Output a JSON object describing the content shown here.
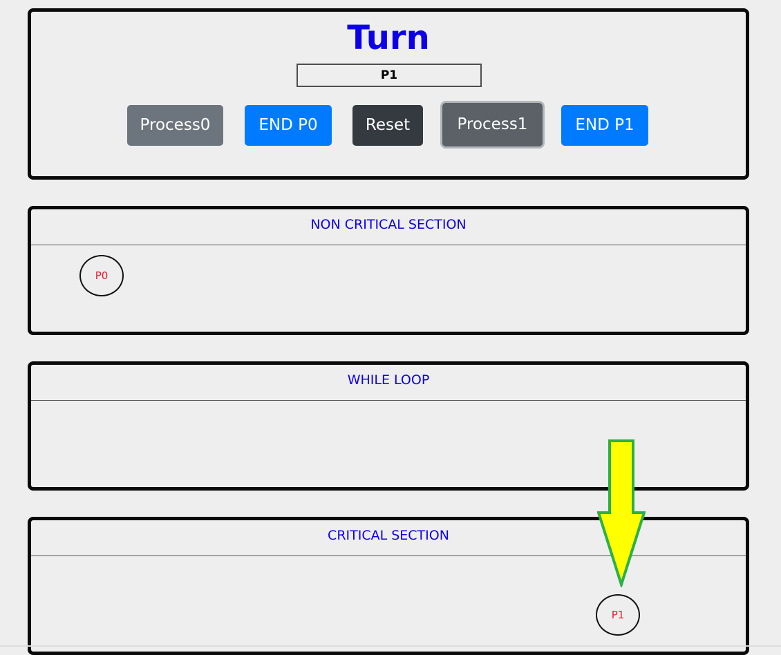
{
  "turn": {
    "title": "Turn",
    "value": "P1"
  },
  "buttons": {
    "process0": "Process0",
    "end_p0": "END P0",
    "reset": "Reset",
    "process1": "Process1",
    "end_p1": "END P1"
  },
  "sections": {
    "non_critical": "NON CRITICAL SECTION",
    "while_loop": "WHILE LOOP",
    "critical": "CRITICAL SECTION"
  },
  "processes": {
    "p0": "P0",
    "p1": "P1"
  },
  "colors": {
    "title_blue": "#0d00e8",
    "process_red": "#e8192a",
    "btn_secondary": "#6c757d",
    "btn_primary": "#007bff",
    "btn_dark": "#343a40",
    "arrow_fill": "#ffff00",
    "arrow_stroke": "#2bb04a"
  },
  "annotation": {
    "icon": "down-arrow-icon"
  }
}
